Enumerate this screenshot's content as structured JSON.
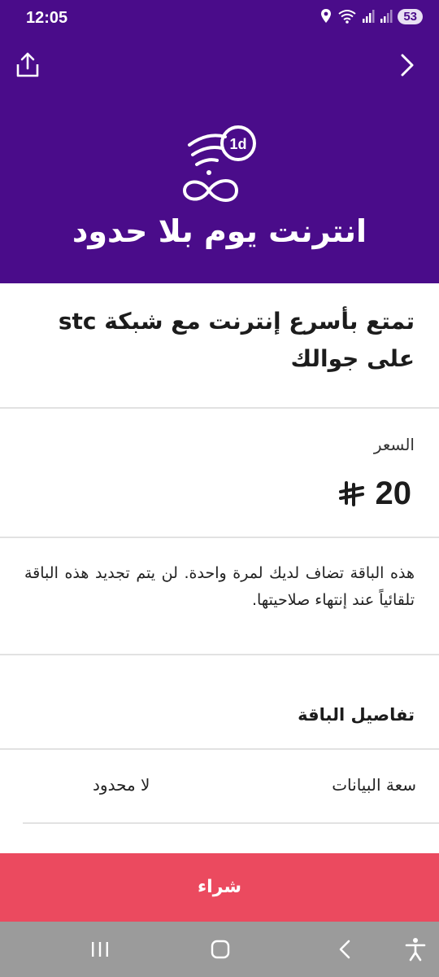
{
  "status_bar": {
    "time": "12:05",
    "battery": "53"
  },
  "header": {
    "title": "انترنت يوم بلا حدود",
    "icon_badge": "1d"
  },
  "subtitle": "تمتع بأسرع إنترنت مع شبكة stc على جوالك",
  "price": {
    "label": "السعر",
    "amount": "20",
    "currency_icon": "riyal-icon"
  },
  "description": "هذه الباقة تضاف لديك لمرة واحدة. لن يتم تجديد هذه الباقة تلقائياً عند إنتهاء صلاحيتها.",
  "details": {
    "heading": "تفاصيل الباقة",
    "rows": [
      {
        "key": "سعة البيانات",
        "value": "لا محدود"
      }
    ]
  },
  "buy_button": {
    "label": "شراء"
  },
  "colors": {
    "brand_purple": "#4a0c8a",
    "buy_red": "#eb4a5f",
    "nav_gray": "#9b9b9b"
  }
}
